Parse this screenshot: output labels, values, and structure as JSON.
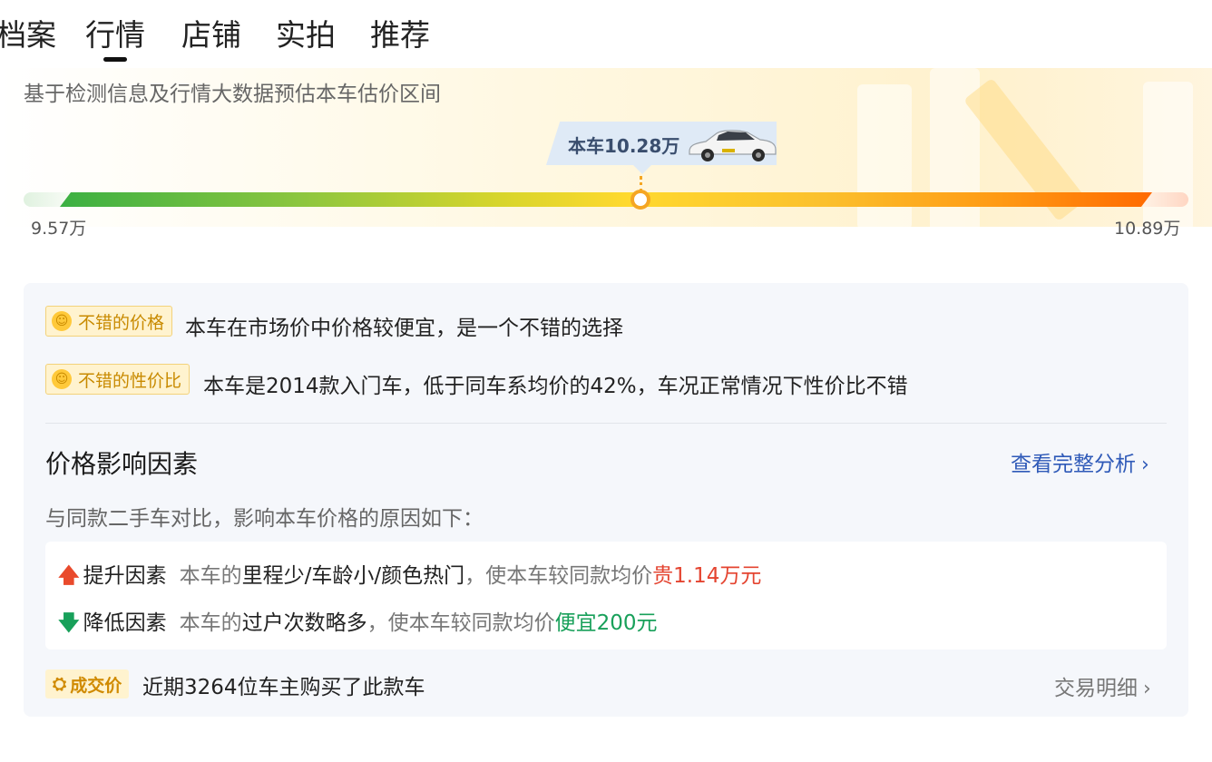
{
  "tabs": [
    {
      "label": "档案"
    },
    {
      "label": "行情",
      "active": true
    },
    {
      "label": "店铺"
    },
    {
      "label": "实拍"
    },
    {
      "label": "推荐"
    }
  ],
  "price_band": {
    "subtitle": "基于检测信息及行情大数据预估本车估价区间",
    "current_label": "本车10.28万",
    "min_label": "9.57万",
    "max_label": "10.89万",
    "current_value": 10.28,
    "min_value": 9.57,
    "max_value": 10.89
  },
  "evaluations": [
    {
      "badge": "不错的价格",
      "text": "本车在市场价中价格较便宜，是一个不错的选择"
    },
    {
      "badge": "不错的性价比",
      "text": "本车是2014款入门车，低于同车系均价的42%，车况正常情况下性价比不错"
    }
  ],
  "factors": {
    "title": "价格影响因素",
    "link": "查看完整分析",
    "desc": "与同款二手车对比，影响本车价格的原因如下：",
    "up": {
      "label": "提升因素",
      "prefix": "本车的",
      "items": "里程少/车龄小/颜色热门",
      "mid": "，使本车较同款均价",
      "effect": "贵1.14万元"
    },
    "down": {
      "label": "降低因素",
      "prefix": "本车的",
      "items": "过户次数略多",
      "mid": "，使本车较同款均价",
      "effect": "便宜200元"
    }
  },
  "deal": {
    "badge": "成交价",
    "text": "近期3264位车主购买了此款车",
    "link": "交易明细"
  },
  "colors": {
    "accent_blue": "#2f5ab8",
    "up_red": "#e44430",
    "down_green": "#18a05a",
    "badge_gold": "#c88a00"
  }
}
